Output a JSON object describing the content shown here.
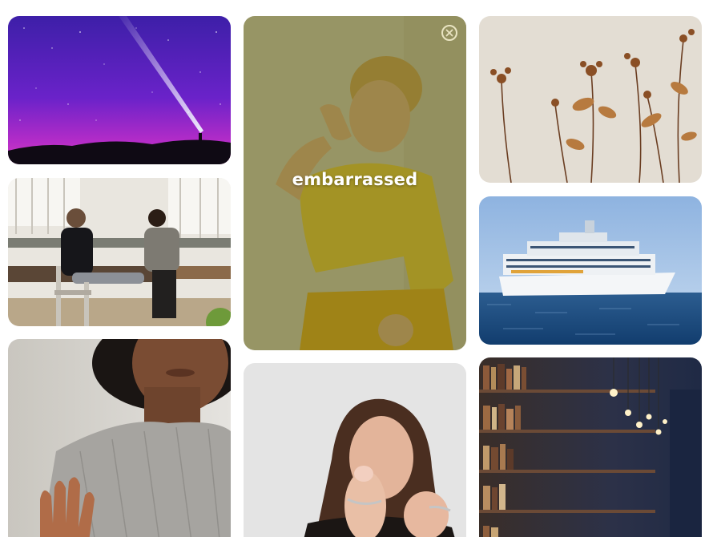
{
  "gallery": {
    "tiles": [
      {
        "photo": "night-sky-flashlight-photo"
      },
      {
        "photo": "office-meeting-photo"
      },
      {
        "photo": "woman-stop-hand-photo"
      },
      {
        "photo": "child-covering-face-photo",
        "caption": "embarrassed",
        "close_icon": "close-icon"
      },
      {
        "photo": "woman-pointing-photo"
      },
      {
        "photo": "dried-flowers-photo"
      },
      {
        "photo": "cruise-ship-photo"
      },
      {
        "photo": "library-bookshelves-photo"
      }
    ],
    "overlay_color": "#5c5804"
  }
}
